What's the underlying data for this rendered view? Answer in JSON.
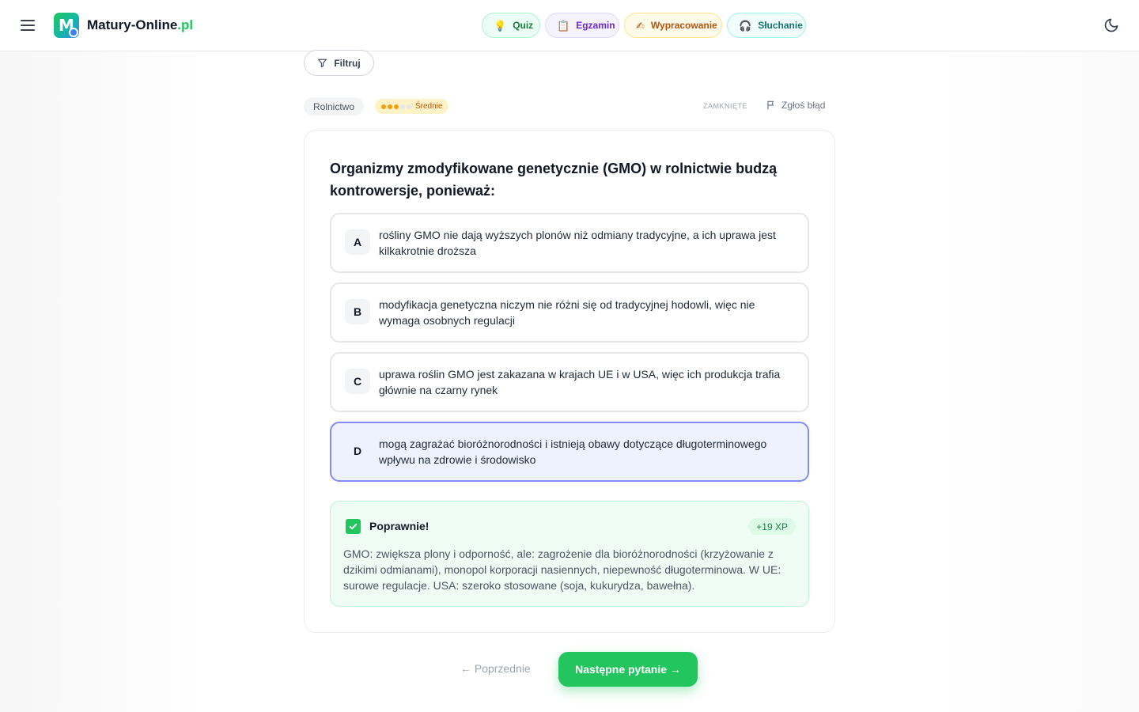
{
  "header": {
    "brand_main": "Matury-Online",
    "brand_tld": ".pl",
    "nav": [
      {
        "label": "Quiz",
        "icon": "lightbulb-icon"
      },
      {
        "label": "Egzamin",
        "icon": "clipboard-icon"
      },
      {
        "label": "Wypracowanie",
        "icon": "writing-hand-icon"
      },
      {
        "label": "Słuchanie",
        "icon": "headphones-icon"
      }
    ]
  },
  "filter": {
    "label": "Filtruj"
  },
  "meta": {
    "category": "Rolnictwo",
    "difficulty_label": "Średnie",
    "difficulty_level": 3,
    "difficulty_max": 5,
    "status": "ZAMKNIĘTE",
    "report_label": "Zgłoś błąd"
  },
  "question": {
    "text": "Organizmy zmodyfikowane genetycznie (GMO) w rolnictwie budzą kontrowersje, ponieważ:",
    "options": [
      {
        "letter": "A",
        "text": "rośliny GMO nie dają wyższych plonów niż odmiany tradycyjne, a ich uprawa jest kilkakrotnie droższa",
        "selected": false
      },
      {
        "letter": "B",
        "text": "modyfikacja genetyczna niczym nie różni się od tradycyjnej hodowli, więc nie wymaga osobnych regulacji",
        "selected": false
      },
      {
        "letter": "C",
        "text": "uprawa roślin GMO jest zakazana w krajach UE i w USA, więc ich produkcja trafia głównie na czarny rynek",
        "selected": false
      },
      {
        "letter": "D",
        "text": "mogą zagrażać bioróżnorodności i istnieją obawy dotyczące długoterminowego wpływu na zdrowie i środowisko",
        "selected": true
      }
    ]
  },
  "result": {
    "title": "Poprawnie!",
    "xp": "+19 XP",
    "explanation": "GMO: zwiększa plony i odporność, ale: zagrożenie dla bioróżnorodności (krzyżowanie z dzikimi odmianami), monopol korporacji nasiennych, niepewność długoterminowa. W UE: surowe regulacje. USA: szeroko stosowane (soja, kukurydza, bawełna)."
  },
  "navigation": {
    "prev_label": "← Poprzednie",
    "next_label": "Następne pytanie →"
  },
  "colors": {
    "accent_green": "#22c55e",
    "selected_border": "#818cf8",
    "selected_bg": "#eef2ff",
    "difficulty": "#f59e0b"
  }
}
